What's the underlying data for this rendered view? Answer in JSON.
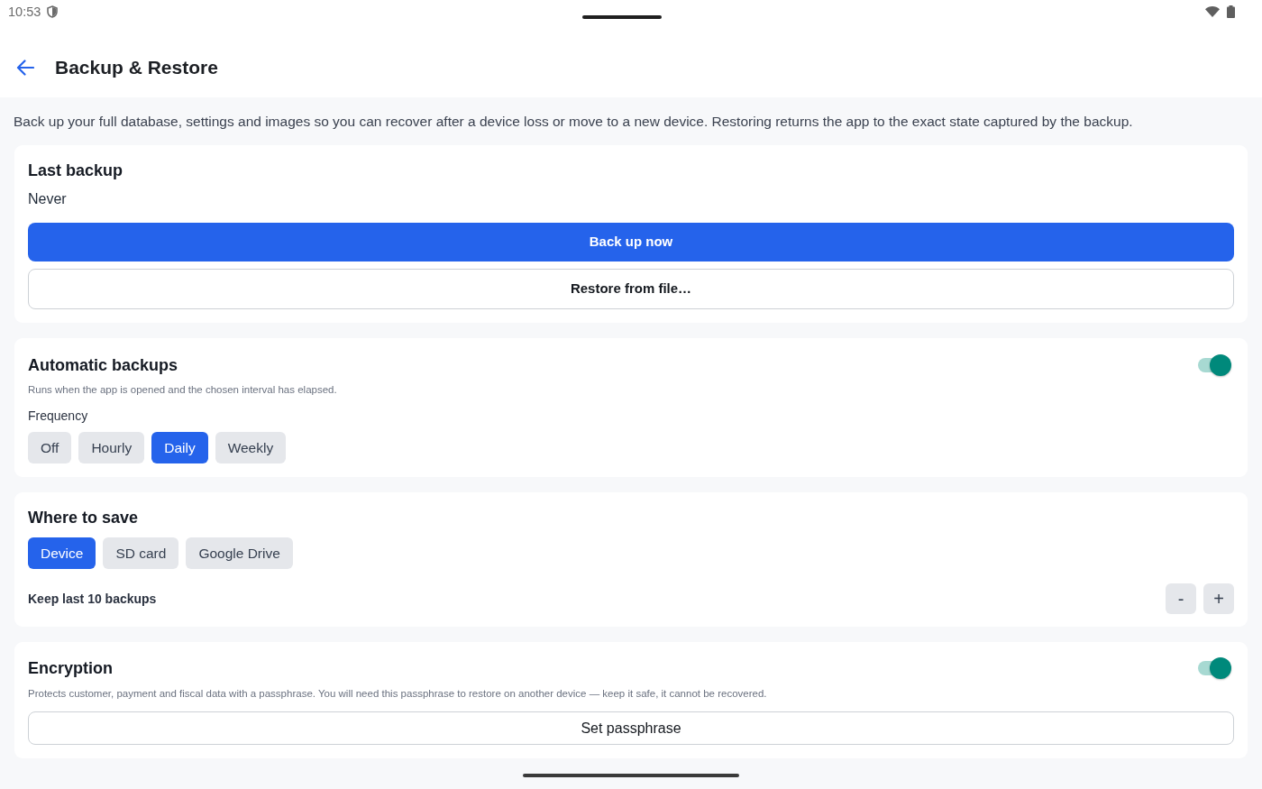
{
  "status_bar": {
    "time": "10:53"
  },
  "app_bar": {
    "title": "Backup & Restore"
  },
  "intro": "Back up your full database, settings and images so you can recover after a device loss or move to a new device. Restoring returns the app to the exact state captured by the backup.",
  "last_backup": {
    "title": "Last backup",
    "value": "Never",
    "buttons": [
      {
        "label": "Back up now",
        "kind": "primary"
      },
      {
        "label": "Restore from file…",
        "kind": "outline_bold"
      }
    ]
  },
  "automatic_backups": {
    "title": "Automatic backups",
    "on": true,
    "description": "Runs when the app is opened and the chosen interval has elapsed.",
    "frequency_label": "Frequency",
    "options": [
      {
        "label": "Off",
        "selected": false
      },
      {
        "label": "Hourly",
        "selected": false
      },
      {
        "label": "Daily",
        "selected": true
      },
      {
        "label": "Weekly",
        "selected": false
      }
    ]
  },
  "where_to_save": {
    "title": "Where to save",
    "options": [
      {
        "label": "Device",
        "selected": true
      },
      {
        "label": "SD card",
        "selected": false
      },
      {
        "label": "Google Drive",
        "selected": false
      }
    ],
    "keep_label": "Keep last 10 backups",
    "decrement": "-",
    "increment": "+"
  },
  "encryption": {
    "title": "Encryption",
    "on": true,
    "description": "Protects customer, payment and fiscal data with a passphrase. You will need this passphrase to restore on another device — keep it safe, it cannot be recovered.",
    "button": {
      "label": "Set passphrase",
      "kind": "outline"
    }
  }
}
